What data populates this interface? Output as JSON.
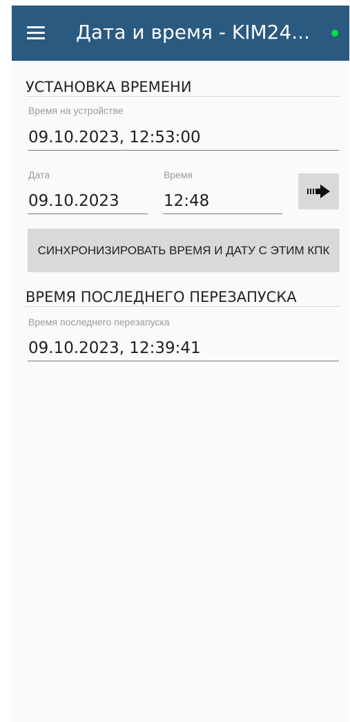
{
  "appbar": {
    "title": "Дата и время - KIM24...",
    "menu_icon": "hamburger-menu-icon",
    "status_color": "#00e040"
  },
  "set_time": {
    "section_title": "УСТАНОВКА ВРЕМЕНИ",
    "device_time_label": "Время на устройстве",
    "device_time_value": "09.10.2023, 12:53:00",
    "date_label": "Дата",
    "date_value": "09.10.2023",
    "time_label": "Время",
    "time_value": "12:48",
    "apply_icon": "arrow-right-icon",
    "sync_button_label": "СИНХРОНИЗИРОВАТЬ ВРЕМЯ И ДАТУ С ЭТИМ КПК"
  },
  "last_restart": {
    "section_title": "ВРЕМЯ ПОСЛЕДНЕГО ПЕРЕЗАПУСКА",
    "label": "Время последнего перезапуска",
    "value": "09.10.2023, 12:39:41"
  },
  "colors": {
    "appbar": "#2a5a7f",
    "background": "#fafafa",
    "button": "#d9d9d9"
  }
}
